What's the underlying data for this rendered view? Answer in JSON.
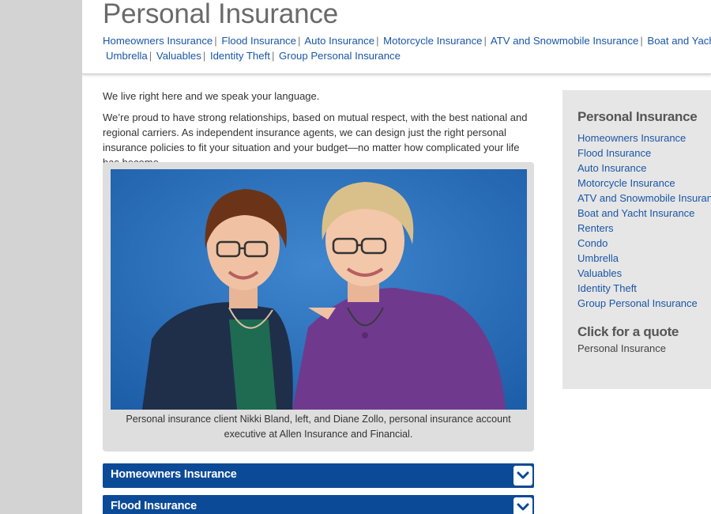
{
  "header": {
    "title": "Personal Insurance",
    "nav_row1": [
      "Homeowners Insurance",
      "Flood Insurance",
      "Auto Insurance",
      "Motorcycle Insurance",
      "ATV and Snowmobile Insurance",
      "Boat and Yacht Insurance"
    ],
    "nav_row2": [
      "Umbrella",
      "Valuables",
      "Identity Theft",
      "Group Personal Insurance"
    ],
    "separator": "|"
  },
  "main": {
    "intro": "We live right here and we speak your language.",
    "body": "We’re proud to have strong relationships, based on mutual respect, with the best national and regional carriers. As independent insurance agents, we can design just the right personal insurance policies to fit your situation and your budget—no matter how complicated your life has become.",
    "photo_caption": "Personal insurance client Nikki Bland, left, and Diane Zollo, personal insurance account executive at Allen Insurance and Financial.",
    "accordions": [
      "Homeowners Insurance",
      "Flood Insurance"
    ]
  },
  "sidebar": {
    "heading": "Personal Insurance",
    "links": [
      "Homeowners Insurance",
      "Flood Insurance",
      "Auto Insurance",
      "Motorcycle Insurance",
      "ATV and Snowmobile Insurance",
      "Boat and Yacht Insurance",
      "Renters",
      "Condo",
      "Umbrella",
      "Valuables",
      "Identity Theft",
      "Group Personal Insurance"
    ],
    "quote_heading": "Click for a quote",
    "quote_link": "Personal Insurance"
  },
  "colors": {
    "link_blue": "#1a56a6",
    "accordion_blue": "#0b4a96",
    "page_gray": "#d3d3d3",
    "sidebar_gray": "#e6e6e6"
  },
  "icons": {
    "accordion_toggle": "chevron-down-icon"
  }
}
